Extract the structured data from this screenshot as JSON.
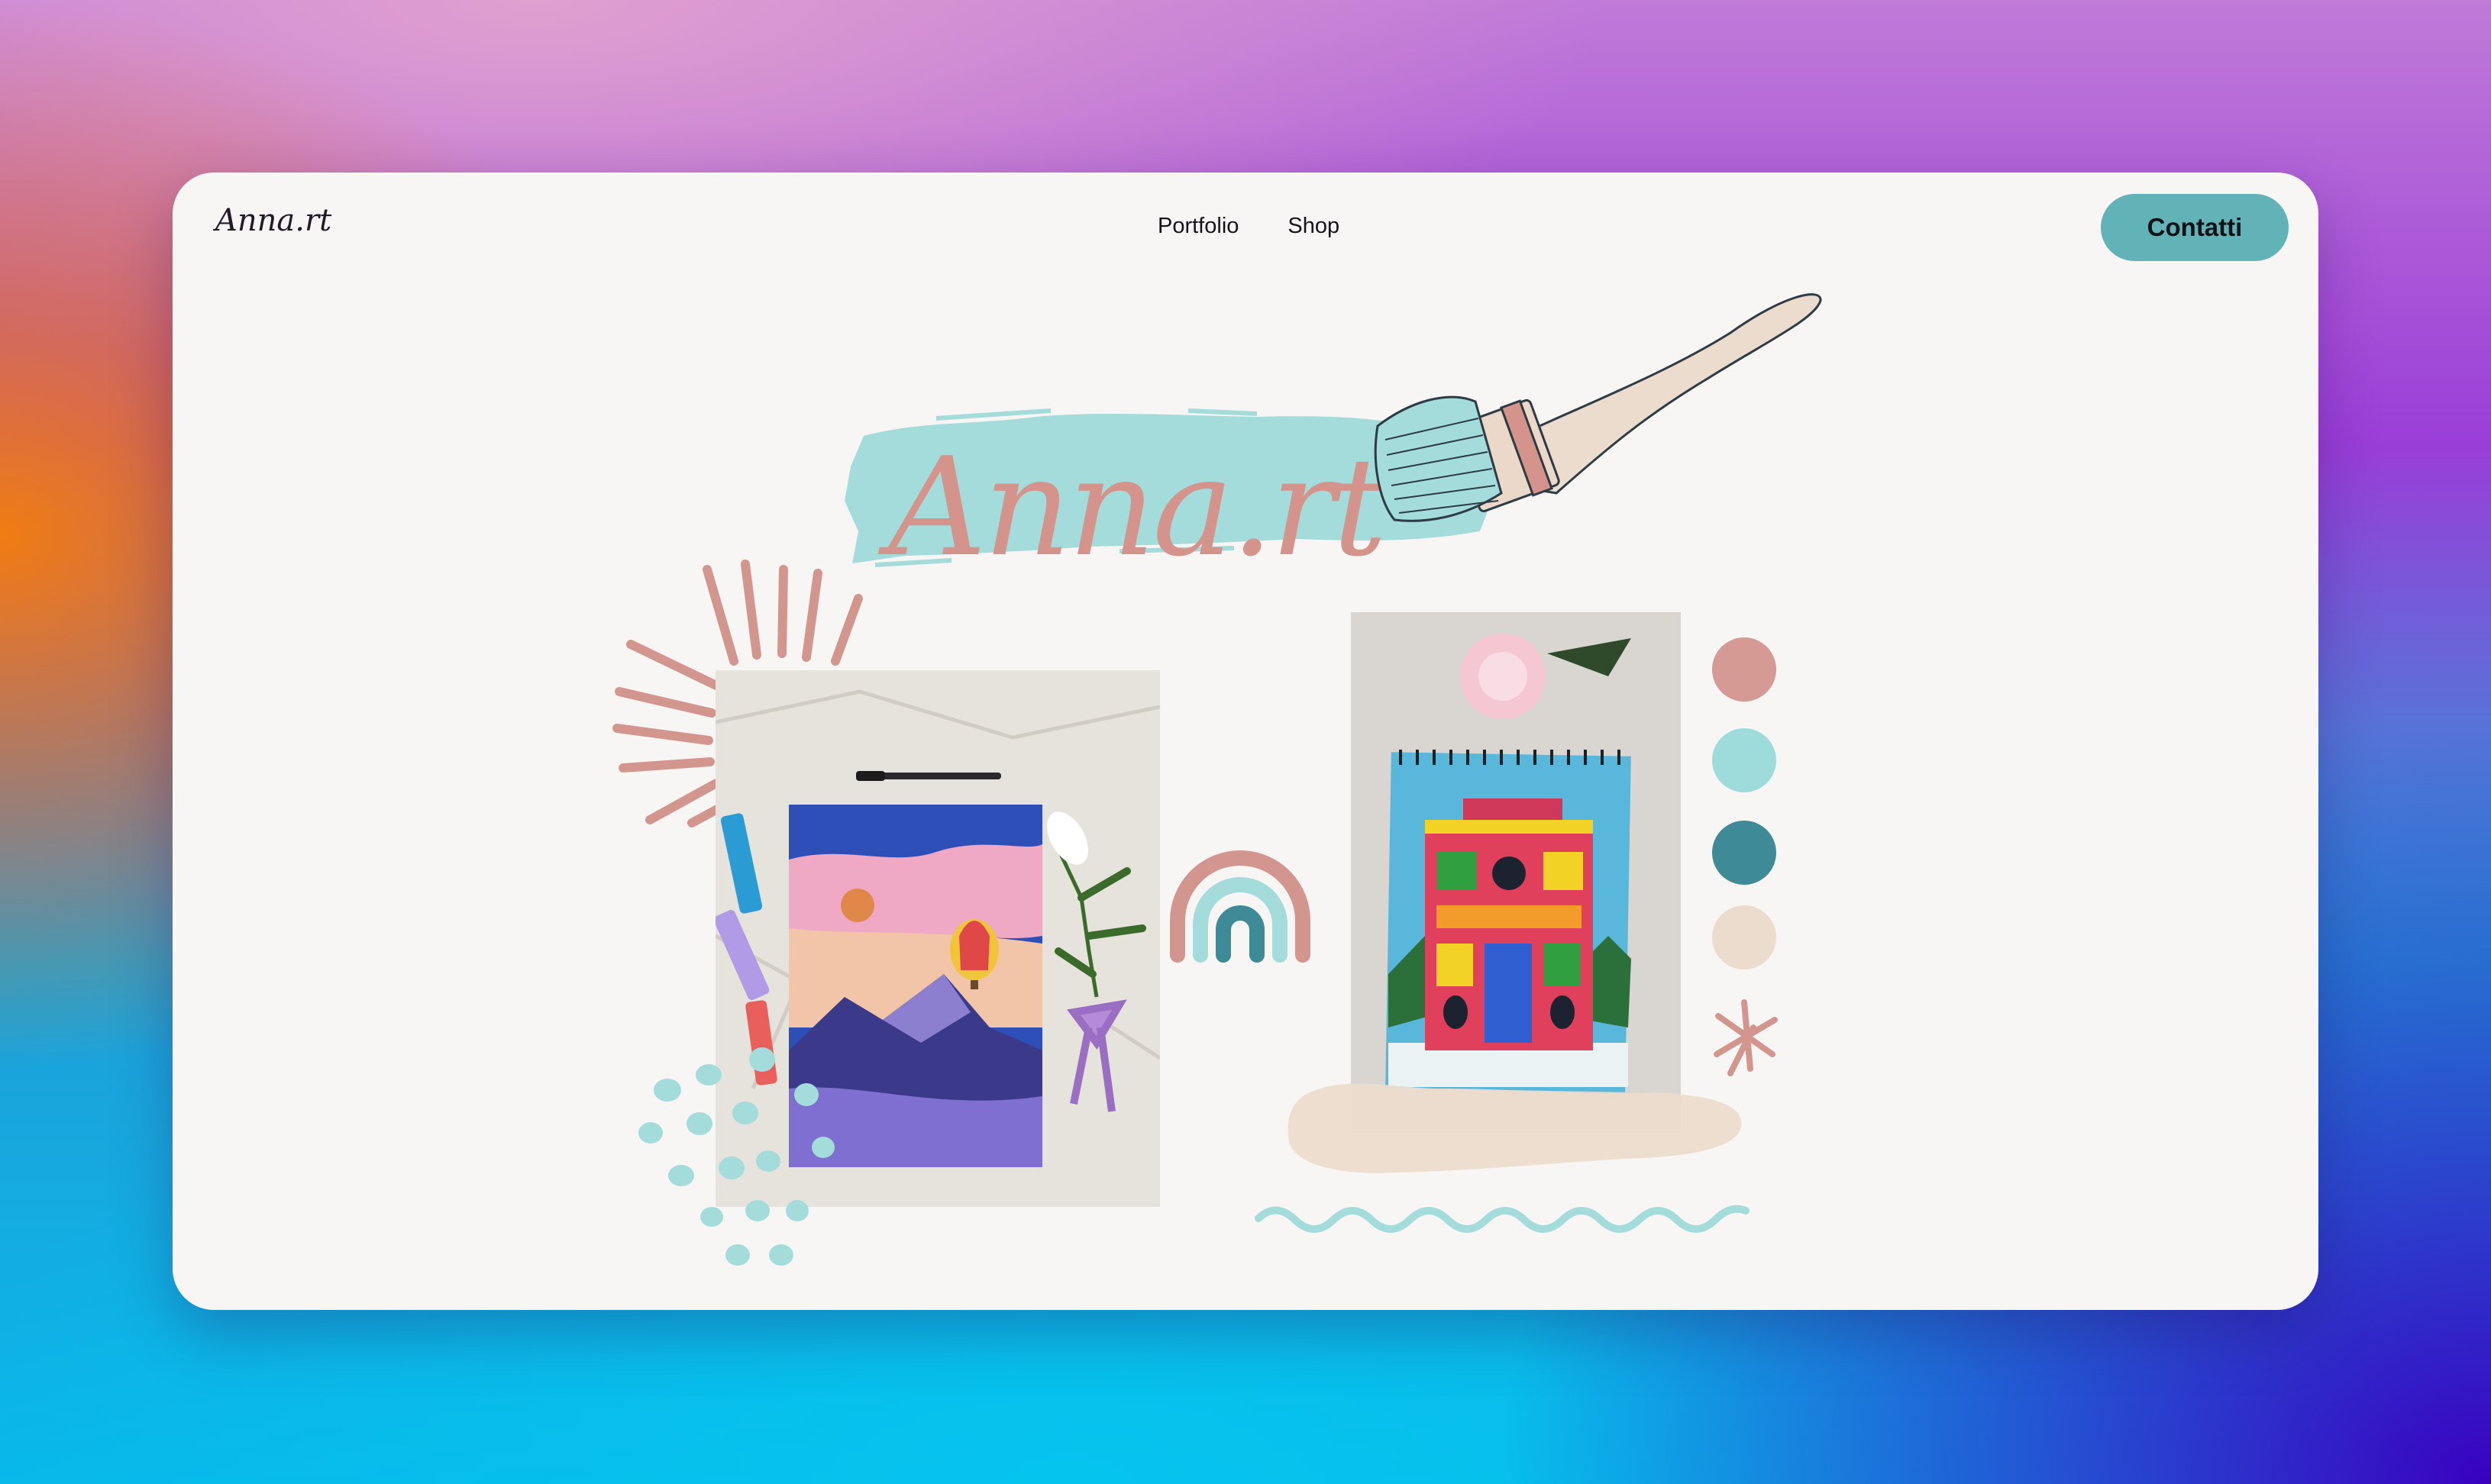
{
  "header": {
    "brand": "Anna.rt",
    "nav": [
      {
        "label": "Portfolio"
      },
      {
        "label": "Shop"
      }
    ],
    "cta_label": "Contatti"
  },
  "hero": {
    "title": "Anna.rt",
    "swatches": [
      "#d49a93",
      "#9edcdc",
      "#3e8a97",
      "#ecdccd"
    ]
  },
  "colors": {
    "accent": "#62b3b8",
    "brush_stroke": "#a3dcdb",
    "title_pink": "#d4948c"
  }
}
